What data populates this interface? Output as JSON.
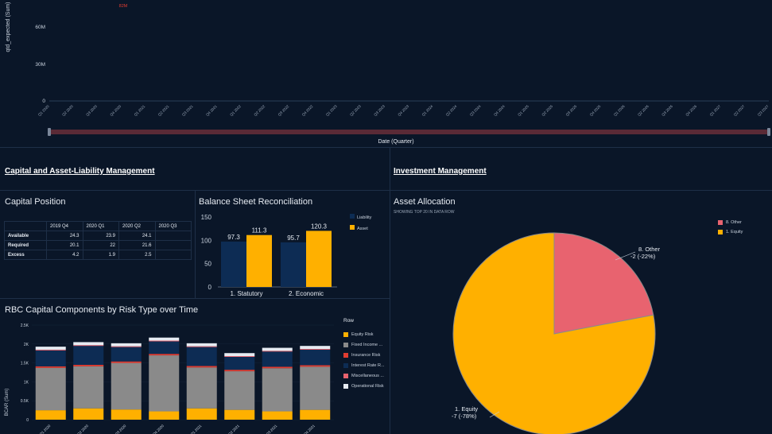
{
  "top_chart": {
    "ylabel": "qtd_expected (Sum)",
    "xlabel": "Date (Quarter)",
    "yticks": [
      "60M",
      "30M",
      "0"
    ],
    "top_label": "82M",
    "xticks": [
      "Q1 2020",
      "Q2 2020",
      "Q3 2020",
      "Q4 2020",
      "Q1 2021",
      "Q2 2021",
      "Q3 2021",
      "Q4 2021",
      "Q1 2022",
      "Q2 2022",
      "Q3 2022",
      "Q4 2022",
      "Q1 2023",
      "Q2 2023",
      "Q3 2023",
      "Q4 2023",
      "Q1 2024",
      "Q2 2024",
      "Q3 2024",
      "Q4 2024",
      "Q1 2025",
      "Q2 2025",
      "Q3 2025",
      "Q4 2025",
      "Q1 2026",
      "Q2 2026",
      "Q3 2026",
      "Q4 2026",
      "Q1 2027",
      "Q2 2027",
      "Q3 2027"
    ]
  },
  "sections": {
    "capital": "Capital and Asset-Liability Management",
    "investment": "Investment Management"
  },
  "capital_position": {
    "title": "Capital Position",
    "columns": [
      "2019 Q4",
      "2020 Q1",
      "2020 Q2",
      "2020 Q3"
    ],
    "rows": [
      {
        "label": "Available",
        "values": [
          "24.3",
          "23.9",
          "24.1",
          ""
        ]
      },
      {
        "label": "Required",
        "values": [
          "20.1",
          "22",
          "21.6",
          ""
        ]
      },
      {
        "label": "Excess",
        "values": [
          "4.2",
          "1.9",
          "2.5",
          ""
        ]
      }
    ]
  },
  "balance_sheet": {
    "title": "Balance Sheet Reconciliation",
    "yticks": [
      "150",
      "100",
      "50",
      "0"
    ],
    "legend": [
      "Liability",
      "Asset"
    ],
    "colors": {
      "liability": "#0d2c54",
      "asset": "#ffb000"
    }
  },
  "rbc": {
    "title": "RBC Capital Components by Risk Type over Time",
    "ylabel": "BCAR (Sum)",
    "yticks": [
      "2.5K",
      "2K",
      "1.5K",
      "1K",
      "0.5K",
      "0"
    ],
    "legend_title": "Row",
    "legend": [
      {
        "label": "Equity Risk",
        "color": "#ffb000"
      },
      {
        "label": "Fixed Income ...",
        "color": "#8a8a8a"
      },
      {
        "label": "Insurance Risk",
        "color": "#e03c31"
      },
      {
        "label": "Interest Rate R...",
        "color": "#0d2c54"
      },
      {
        "label": "Miscellaneous ...",
        "color": "#e8636f"
      },
      {
        "label": "Operational Risk",
        "color": "#e6ebf2"
      }
    ],
    "xticks": [
      "Q1 2020",
      "Q2 2020",
      "Q3 2020",
      "Q4 2020",
      "Q1 2021",
      "Q2 2021",
      "Q3 2021",
      "Q4 2021"
    ]
  },
  "asset_allocation": {
    "title": "Asset Allocation",
    "subtitle": "SHOWING TOP 20 IN DATA ROW",
    "legend": [
      {
        "label": "8. Other",
        "color": "#e8636f"
      },
      {
        "label": "1. Equity",
        "color": "#ffb000"
      }
    ],
    "labels": {
      "other_name": "8. Other",
      "other_val": "-2 (-22%)",
      "equity_name": "1. Equity",
      "equity_val": "-7 (-78%)"
    }
  },
  "chart_data": [
    {
      "type": "bar",
      "title": "Balance Sheet Reconciliation",
      "categories": [
        "1. Statutory",
        "2. Economic"
      ],
      "series": [
        {
          "name": "Liability",
          "values": [
            97.3,
            95.7
          ]
        },
        {
          "name": "Asset",
          "values": [
            111.3,
            120.3
          ]
        }
      ],
      "ylim": [
        0,
        150
      ]
    },
    {
      "type": "bar",
      "title": "RBC Capital Components by Risk Type over Time",
      "ylabel": "BCAR (Sum)",
      "categories": [
        "Q1 2020",
        "Q2 2020",
        "Q3 2020",
        "Q4 2020",
        "Q1 2021",
        "Q2 2021",
        "Q3 2021",
        "Q4 2021"
      ],
      "series": [
        {
          "name": "Equity Risk",
          "values": [
            250,
            300,
            270,
            220,
            300,
            260,
            220,
            260
          ]
        },
        {
          "name": "Fixed Income ...",
          "values": [
            1120,
            1110,
            1230,
            1480,
            1080,
            1020,
            1140,
            1140
          ]
        },
        {
          "name": "Insurance Risk",
          "values": [
            40,
            40,
            40,
            40,
            40,
            40,
            40,
            40
          ]
        },
        {
          "name": "Interest Rate R...",
          "values": [
            420,
            500,
            380,
            330,
            500,
            340,
            400,
            410
          ]
        },
        {
          "name": "Miscellaneous ...",
          "values": [
            20,
            20,
            20,
            20,
            20,
            20,
            20,
            20
          ]
        },
        {
          "name": "Operational Risk",
          "values": [
            80,
            80,
            80,
            80,
            80,
            80,
            80,
            80
          ]
        }
      ],
      "ylim": [
        0,
        2500
      ],
      "stacked": true
    },
    {
      "type": "pie",
      "title": "Asset Allocation",
      "categories": [
        "8. Other",
        "1. Equity"
      ],
      "values": [
        -2,
        -7
      ],
      "percent": [
        22,
        78
      ]
    }
  ]
}
